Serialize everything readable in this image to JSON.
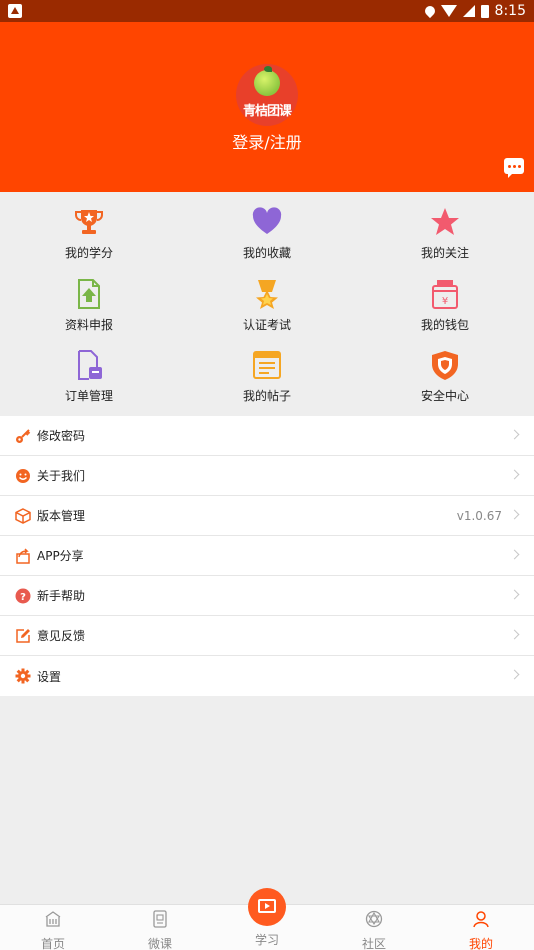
{
  "status_bar": {
    "time": "8:15"
  },
  "header": {
    "logo_text": "青桔团课",
    "login_label": "登录/注册"
  },
  "grid": [
    {
      "label": "我的学分",
      "icon": "trophy-icon",
      "color": "#f26522"
    },
    {
      "label": "我的收藏",
      "icon": "heart-icon",
      "color": "#8e66d6"
    },
    {
      "label": "我的关注",
      "icon": "star-icon",
      "color": "#f25a6e"
    },
    {
      "label": "资料申报",
      "icon": "upload-document-icon",
      "color": "#7ab648"
    },
    {
      "label": "认证考试",
      "icon": "medal-icon",
      "color": "#f5a623"
    },
    {
      "label": "我的钱包",
      "icon": "wallet-icon",
      "color": "#f25a6e"
    },
    {
      "label": "订单管理",
      "icon": "order-document-icon",
      "color": "#8e66d6"
    },
    {
      "label": "我的帖子",
      "icon": "post-icon",
      "color": "#f5a623"
    },
    {
      "label": "安全中心",
      "icon": "shield-icon",
      "color": "#f26522"
    }
  ],
  "menu": [
    {
      "label": "修改密码",
      "icon": "key-icon",
      "value": ""
    },
    {
      "label": "关于我们",
      "icon": "smiley-icon",
      "value": ""
    },
    {
      "label": "版本管理",
      "icon": "box-icon",
      "value": "v1.0.67"
    },
    {
      "label": "APP分享",
      "icon": "share-icon",
      "value": ""
    },
    {
      "label": "新手帮助",
      "icon": "help-icon",
      "value": ""
    },
    {
      "label": "意见反馈",
      "icon": "edit-icon",
      "value": ""
    },
    {
      "label": "设置",
      "icon": "gear-icon",
      "value": ""
    }
  ],
  "tabs": [
    {
      "label": "首页",
      "icon": "home-icon"
    },
    {
      "label": "微课",
      "icon": "micro-course-icon"
    },
    {
      "label": "学习",
      "icon": "study-icon"
    },
    {
      "label": "社区",
      "icon": "community-icon"
    },
    {
      "label": "我的",
      "icon": "profile-icon"
    }
  ],
  "colors": {
    "accent": "#ff4500",
    "status_bar": "#9a2a00"
  }
}
